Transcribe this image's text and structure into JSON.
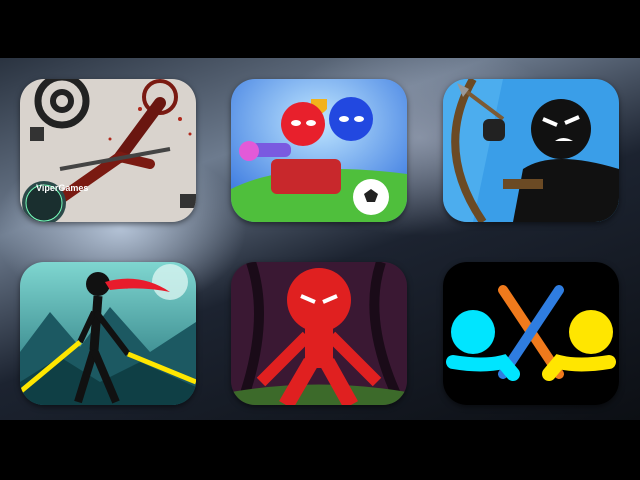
{
  "apps": [
    {
      "id": "ragdoll",
      "icon": "stickman-ragdoll-icon",
      "badge": "ViperGames",
      "colors": {
        "bg": "#d8d2cc",
        "accent": "#b0281c"
      }
    },
    {
      "id": "party",
      "icon": "stickman-party-icon",
      "colors": {
        "bg": "#5aa0ff",
        "accent": "#e8202c"
      }
    },
    {
      "id": "archer",
      "icon": "stickman-archer-icon",
      "colors": {
        "bg": "#3fa0e8",
        "accent": "#111111"
      }
    },
    {
      "id": "ninja",
      "icon": "stickman-ninja-icon",
      "colors": {
        "bg": "#2f8f96",
        "accent": "#ffe600"
      }
    },
    {
      "id": "red-stickman",
      "icon": "red-stickman-icon",
      "colors": {
        "bg": "#3b1a33",
        "accent": "#e02020"
      }
    },
    {
      "id": "supreme-duelist",
      "icon": "stickman-duel-icon",
      "colors": {
        "bg": "#000000",
        "accent": "#00e5ff"
      }
    }
  ]
}
